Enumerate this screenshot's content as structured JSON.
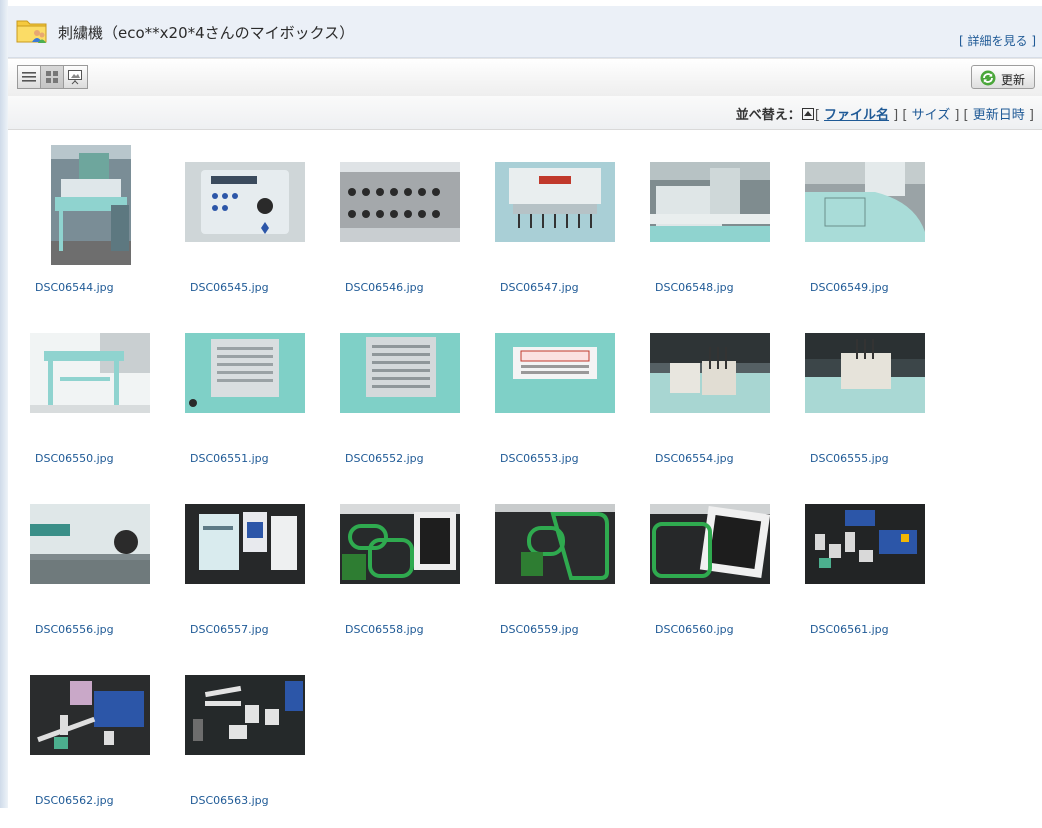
{
  "header": {
    "title": "刺繍機（eco**x20*4さんのマイボックス）",
    "detail_link": "詳細を見る"
  },
  "toolbar": {
    "refresh_label": "更新",
    "view_modes": [
      "list",
      "thumbnail",
      "slideshow"
    ],
    "active_view": "thumbnail"
  },
  "sort": {
    "label": "並べ替え：",
    "options": [
      "ファイル名",
      "サイズ",
      "更新日時"
    ],
    "active": "ファイル名"
  },
  "files": [
    {
      "name": "DSC06544.jpg",
      "orientation": "portrait"
    },
    {
      "name": "DSC06545.jpg",
      "orientation": "landscape"
    },
    {
      "name": "DSC06546.jpg",
      "orientation": "landscape"
    },
    {
      "name": "DSC06547.jpg",
      "orientation": "landscape"
    },
    {
      "name": "DSC06548.jpg",
      "orientation": "landscape"
    },
    {
      "name": "DSC06549.jpg",
      "orientation": "landscape"
    },
    {
      "name": "DSC06550.jpg",
      "orientation": "landscape"
    },
    {
      "name": "DSC06551.jpg",
      "orientation": "landscape"
    },
    {
      "name": "DSC06552.jpg",
      "orientation": "landscape"
    },
    {
      "name": "DSC06553.jpg",
      "orientation": "landscape"
    },
    {
      "name": "DSC06554.jpg",
      "orientation": "landscape"
    },
    {
      "name": "DSC06555.jpg",
      "orientation": "landscape"
    },
    {
      "name": "DSC06556.jpg",
      "orientation": "landscape"
    },
    {
      "name": "DSC06557.jpg",
      "orientation": "landscape"
    },
    {
      "name": "DSC06558.jpg",
      "orientation": "landscape"
    },
    {
      "name": "DSC06559.jpg",
      "orientation": "landscape"
    },
    {
      "name": "DSC06560.jpg",
      "orientation": "landscape"
    },
    {
      "name": "DSC06561.jpg",
      "orientation": "landscape"
    },
    {
      "name": "DSC06562.jpg",
      "orientation": "landscape"
    },
    {
      "name": "DSC06563.jpg",
      "orientation": "landscape"
    }
  ],
  "colors": {
    "link": "#1f5a96",
    "header_bg": "#ebf0f7",
    "machine_teal": "#8fd3cf"
  }
}
